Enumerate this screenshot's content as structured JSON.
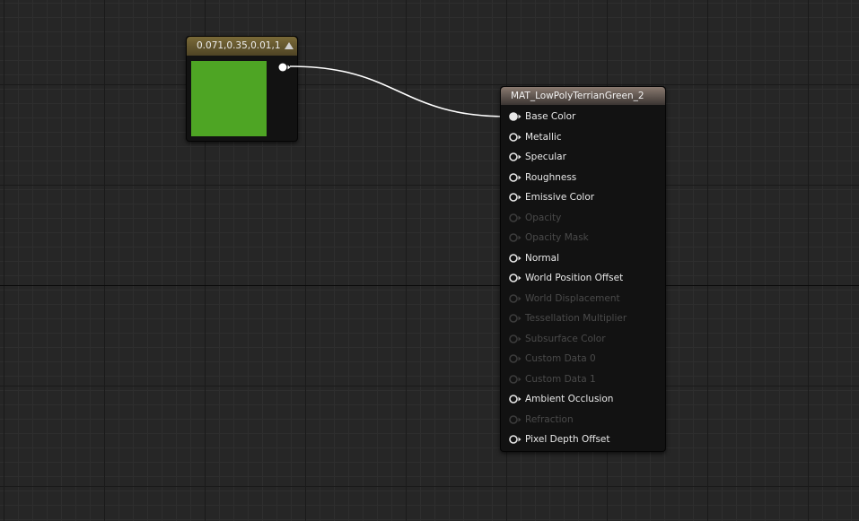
{
  "constant_node": {
    "title": "0.071,0.35,0.01,1",
    "color": "#4ea524"
  },
  "material_node": {
    "title": "MAT_LowPolyTerrianGreen_2",
    "inputs": [
      {
        "label": "Base Color",
        "connected": true,
        "enabled": true
      },
      {
        "label": "Metallic",
        "connected": false,
        "enabled": true
      },
      {
        "label": "Specular",
        "connected": false,
        "enabled": true
      },
      {
        "label": "Roughness",
        "connected": false,
        "enabled": true
      },
      {
        "label": "Emissive Color",
        "connected": false,
        "enabled": true
      },
      {
        "label": "Opacity",
        "connected": false,
        "enabled": false
      },
      {
        "label": "Opacity Mask",
        "connected": false,
        "enabled": false
      },
      {
        "label": "Normal",
        "connected": false,
        "enabled": true
      },
      {
        "label": "World Position Offset",
        "connected": false,
        "enabled": true
      },
      {
        "label": "World Displacement",
        "connected": false,
        "enabled": false
      },
      {
        "label": "Tessellation Multiplier",
        "connected": false,
        "enabled": false
      },
      {
        "label": "Subsurface Color",
        "connected": false,
        "enabled": false
      },
      {
        "label": "Custom Data 0",
        "connected": false,
        "enabled": false
      },
      {
        "label": "Custom Data 1",
        "connected": false,
        "enabled": false
      },
      {
        "label": "Ambient Occlusion",
        "connected": false,
        "enabled": true
      },
      {
        "label": "Refraction",
        "connected": false,
        "enabled": false
      },
      {
        "label": "Pixel Depth Offset",
        "connected": false,
        "enabled": true
      }
    ]
  },
  "colors": {
    "graph_background": "#262626",
    "constant_header": "#6e5f34",
    "material_header": "#6b5f58",
    "wire": "#ffffff"
  }
}
